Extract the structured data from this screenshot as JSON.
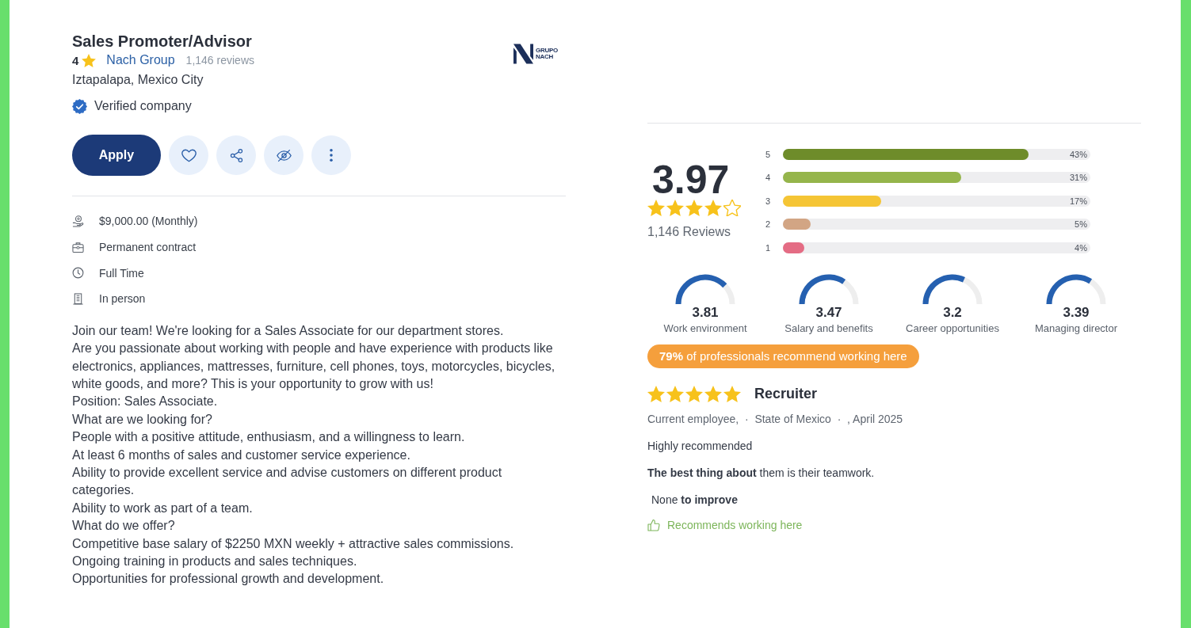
{
  "job": {
    "title": "Sales Promoter/Advisor",
    "company_rating": "4",
    "company": "Nach Group",
    "reviews": "1,146 reviews",
    "location": "Iztapalapa, Mexico City",
    "verified": "Verified company",
    "logo_text": "GRUPO NACH",
    "apply_button": "Apply",
    "actions": [
      {
        "kind": "favorite"
      },
      {
        "kind": "share"
      },
      {
        "kind": "hide"
      },
      {
        "kind": "more"
      }
    ],
    "details": [
      {
        "kind": "salary",
        "text": "$9,000.00 (Monthly)"
      },
      {
        "kind": "contract",
        "text": "Permanent contract"
      },
      {
        "kind": "schedule",
        "text": "Full Time"
      },
      {
        "kind": "workplace",
        "text": "In person"
      }
    ],
    "description": [
      "Join our team! We're looking for a Sales Associate for our department stores.",
      "Are you passionate about working with people and have experience with products like electronics, appliances, mattresses, furniture, cell phones, toys, motorcycles, bicycles, white goods, and more? This is your opportunity to grow with us!",
      "Position: Sales Associate.",
      "What are we looking for?",
      "People with a positive attitude, enthusiasm, and a willingness to learn.",
      "At least 6 months of sales and customer service experience.",
      "Ability to provide excellent service and advise customers on different product categories.",
      "Ability to work as part of a team.",
      "What do we offer?",
      "Competitive base salary of $2250 MXN weekly + attractive sales commissions.",
      "Ongoing training in products and sales techniques.",
      "Opportunities for professional growth and development."
    ]
  },
  "ratings": {
    "average": "3.97",
    "stars": 4,
    "count": "1,146 Reviews",
    "distribution": [
      {
        "label": "5",
        "level": 0.8,
        "percent": "43%",
        "color": "#6e8c2a"
      },
      {
        "label": "4",
        "level": 0.58,
        "percent": "31%",
        "color": "#95b54b"
      },
      {
        "label": "3",
        "level": 0.32,
        "percent": "17%",
        "color": "#f5c535"
      },
      {
        "label": "2",
        "level": 0.09,
        "percent": "5%",
        "color": "#d2a584"
      },
      {
        "label": "1",
        "level": 0.07,
        "percent": "4%",
        "color": "#e46c84"
      }
    ],
    "categories": [
      {
        "value": "3.81",
        "label": "Work environment",
        "level": 0.76
      },
      {
        "value": "3.47",
        "label": "Salary and benefits",
        "level": 0.69
      },
      {
        "value": "3.2",
        "label": "Career opportunities",
        "level": 0.64
      },
      {
        "value": "3.39",
        "label": "Managing director",
        "level": 0.68
      }
    ],
    "recommend": "**79%** of professionals recommend working here"
  },
  "review": {
    "stars": 5,
    "title": "Recruiter",
    "meta": "Current employee,  ·  State of Mexico  ·  , April 2025",
    "headline": "Highly recommended",
    "pros": "**The best thing about**  them is their teamwork.",
    "cons": "None **to improve**",
    "recommendation": "Recommends working here"
  }
}
